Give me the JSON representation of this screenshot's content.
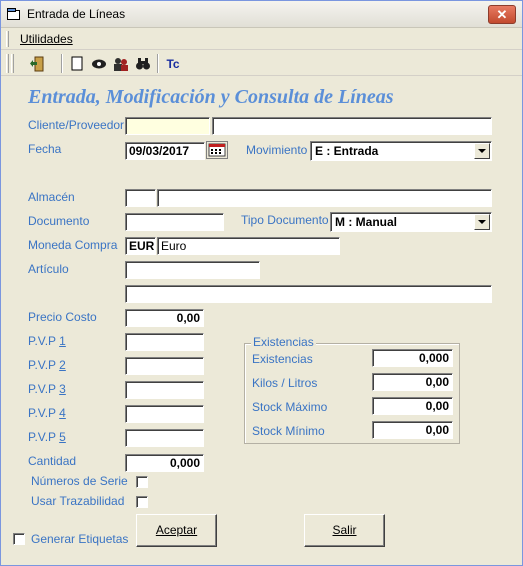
{
  "window": {
    "title": "Entrada de Líneas",
    "close_label": "✕"
  },
  "menu": {
    "utilidades": "Utilidades"
  },
  "toolbar": {
    "tc_label": "Tc"
  },
  "form": {
    "heading": "Entrada, Modificación y Consulta de Líneas",
    "cliente_label": "Cliente/Proveedor",
    "cliente_code": "",
    "cliente_name": "",
    "fecha_label": "Fecha",
    "fecha_value": "09/03/2017",
    "movimiento_label": "Movimiento",
    "movimiento_value": "E : Entrada",
    "almacen_label": "Almacén",
    "almacen_code": "",
    "almacen_name": "",
    "documento_label": "Documento",
    "documento_value": "",
    "tipo_documento_label": "Tipo Documento",
    "tipo_documento_value": "M : Manual",
    "moneda_label": "Moneda Compra",
    "moneda_code": "EUR",
    "moneda_name": "Euro",
    "articulo_label": "Artículo",
    "articulo_code": "",
    "articulo_desc": "",
    "precio_costo_label": "Precio Costo",
    "precio_costo_value": "0,00",
    "pvp_prefix": "P.V.P ",
    "pvp": [
      {
        "num": "1",
        "value": ""
      },
      {
        "num": "2",
        "value": ""
      },
      {
        "num": "3",
        "value": ""
      },
      {
        "num": "4",
        "value": ""
      },
      {
        "num": "5",
        "value": ""
      }
    ],
    "cantidad_label": "Cantidad",
    "cantidad_value": "0,000",
    "numeros_serie_label": "Números de Serie",
    "numeros_serie_checked": false,
    "usar_trazabilidad_label": "Usar Trazabilidad",
    "usar_trazabilidad_checked": false,
    "generar_etiquetas_label": "Generar Etiquetas",
    "generar_etiquetas_checked": false
  },
  "existencias": {
    "group_title": "Existencias",
    "existencias_label": "Existencias",
    "existencias_value": "0,000",
    "kilos_label": "Kilos / Litros",
    "kilos_value": "0,00",
    "stock_max_label": "Stock Máximo",
    "stock_max_value": "0,00",
    "stock_min_label": "Stock Mínimo",
    "stock_min_value": "0,00"
  },
  "buttons": {
    "aceptar": "Aceptar",
    "salir": "Salir"
  },
  "colors": {
    "label_blue": "#3a74c4",
    "heading_blue": "#5b8fd8",
    "highlight_field": "#ffffe0",
    "window_bg": "#ece9d8"
  }
}
